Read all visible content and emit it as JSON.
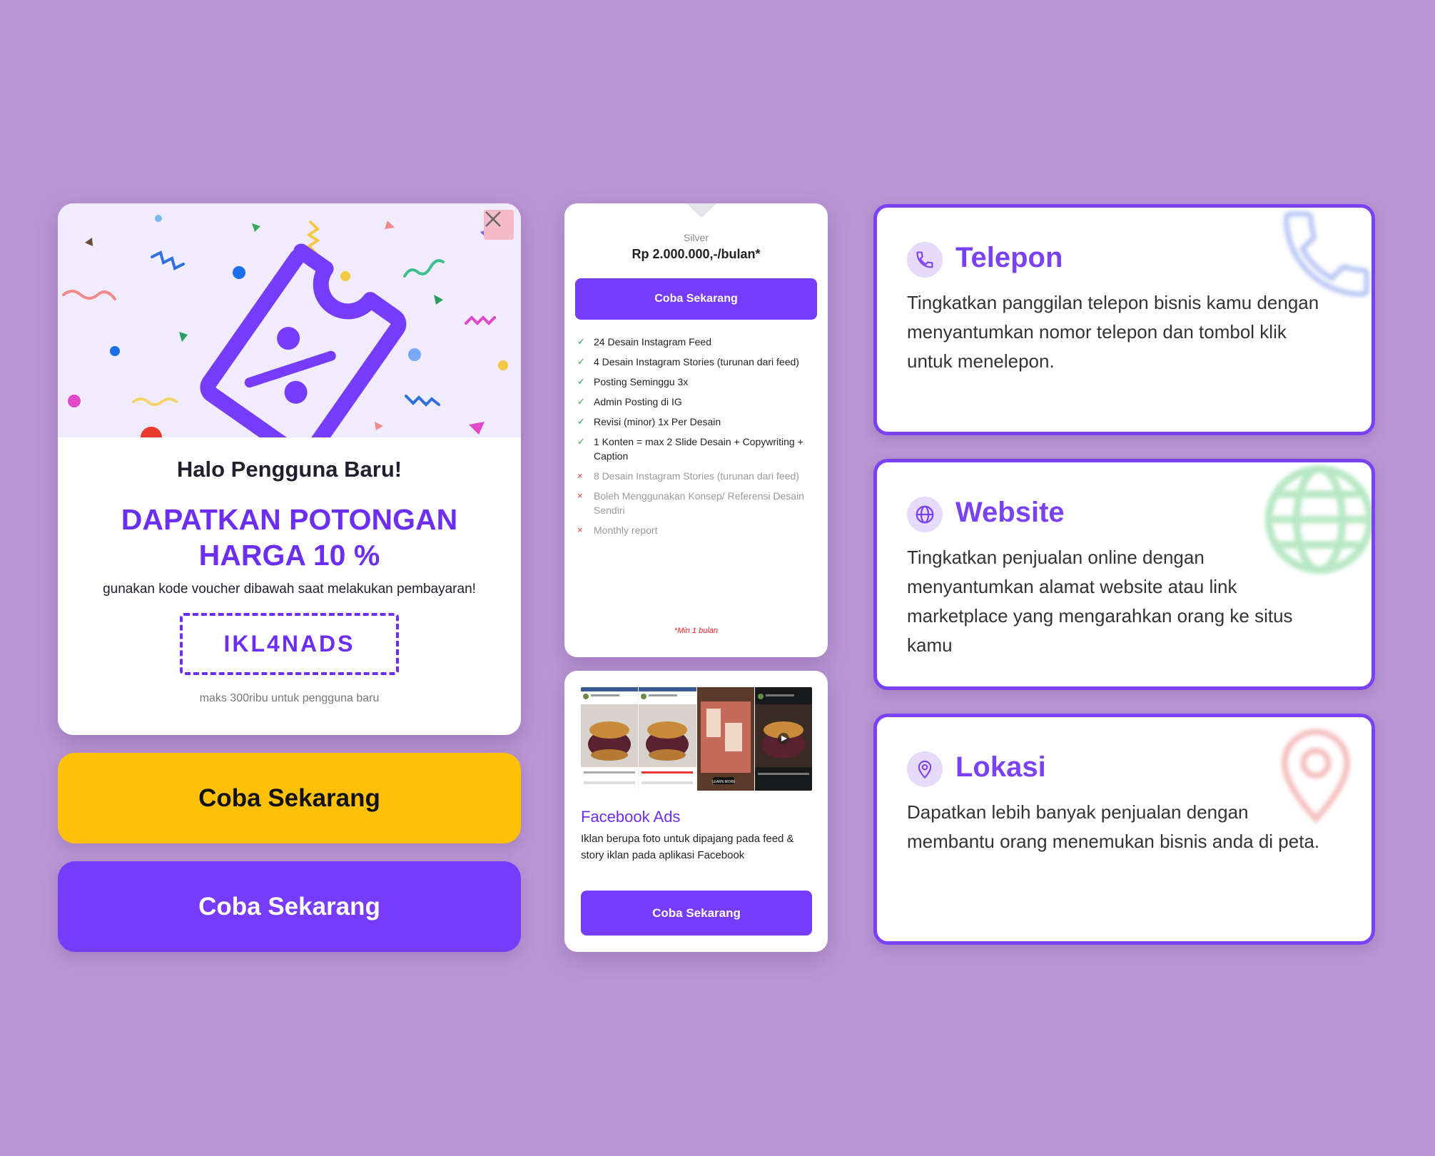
{
  "colors": {
    "background": "#ba96d4",
    "primary": "#763cf9",
    "accent_yellow": "#ffc107",
    "check_green": "#2fa64a",
    "cross_red": "#e0474c"
  },
  "promo": {
    "close_icon": "close-icon",
    "greeting": "Halo Pengguna Baru!",
    "headline": "DAPATKAN POTONGAN HARGA 10 %",
    "instruction": "gunakan kode voucher dibawah saat melakukan pembayaran!",
    "voucher_code": "IKL4NADS",
    "note": "maks 300ribu untuk pengguna baru"
  },
  "buttons": {
    "yellow_label": "Coba Sekarang",
    "purple_label": "Coba Sekarang"
  },
  "pricing": {
    "plan_name": "Silver",
    "price": "Rp 2.000.000,-/bulan*",
    "cta_label": "Coba Sekarang",
    "features": [
      {
        "text": "24 Desain Instagram Feed",
        "included": true
      },
      {
        "text": "4 Desain Instagram Stories (turunan dari feed)",
        "included": true
      },
      {
        "text": "Posting Seminggu 3x",
        "included": true
      },
      {
        "text": "Admin Posting di IG",
        "included": true
      },
      {
        "text": "Revisi (minor) 1x Per Desain",
        "included": true
      },
      {
        "text": "1 Konten = max 2 Slide Desain + Copywriting + Caption",
        "included": true
      },
      {
        "text": "8 Desain Instagram Stories (turunan dari feed)",
        "included": false
      },
      {
        "text": "Boleh Menggunakan Konsep/ Referensi Desain Sendiri",
        "included": false
      },
      {
        "text": "Monthly report",
        "included": false
      }
    ],
    "footnote": "*Min 1 bulan"
  },
  "facebook_ads": {
    "title": "Facebook Ads",
    "description": "Iklan berupa foto untuk dipajang pada feed & story iklan pada aplikasi Facebook",
    "cta_label": "Coba Sekarang",
    "preview_badge": "LEARN MORE"
  },
  "features": [
    {
      "key": "telepon",
      "icon": "phone-icon",
      "title": "Telepon",
      "description": "Tingkatkan panggilan telepon bisnis kamu dengan menyantumkan nomor telepon dan tombol klik untuk menelepon."
    },
    {
      "key": "website",
      "icon": "globe-icon",
      "title": "Website",
      "description": "Tingkatkan penjualan online dengan menyantumkan alamat website atau link marketplace yang mengarahkan orang ke situs kamu"
    },
    {
      "key": "lokasi",
      "icon": "location-pin-icon",
      "title": "Lokasi",
      "description": "Dapatkan lebih banyak penjualan dengan membantu orang menemukan bisnis anda di peta."
    }
  ]
}
